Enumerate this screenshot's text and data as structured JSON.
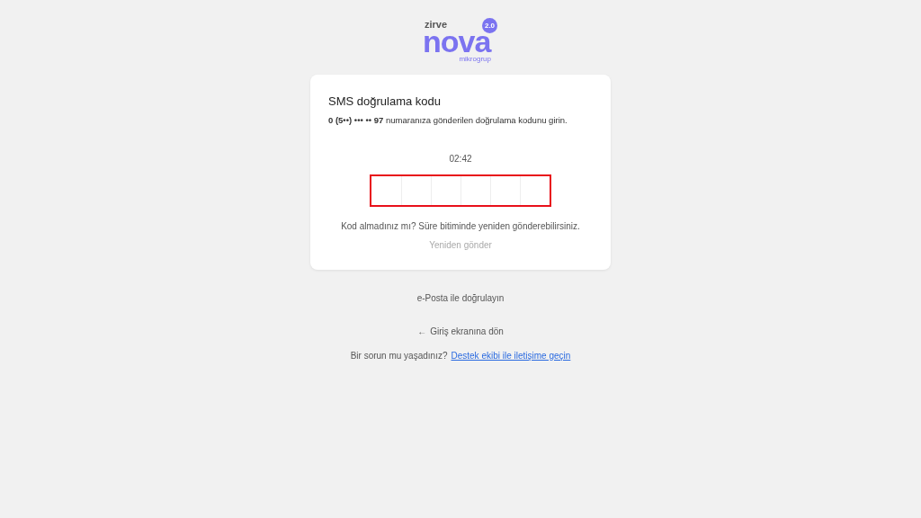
{
  "logo": {
    "top": "zirve",
    "main": "nova",
    "badge": "2.0",
    "bottom": "mikrogrup"
  },
  "card": {
    "title": "SMS doğrulama kodu",
    "message": "**0 (5••) ••• •• 97** numaranıza gönderilen doğrulama kodunu girin.",
    "timer": "02:42",
    "code": {
      "error": true,
      "cells": [
        {
          "filled": false
        },
        {
          "filled": false
        },
        {
          "filled": false
        },
        {
          "filled": false
        },
        {
          "filled": false
        },
        {
          "filled": false
        }
      ]
    },
    "hint": "Kod almadınız mı? Süre bitiminde yeniden gönderebilirsiniz.",
    "resend": {
      "label": "Yeniden gönder",
      "disabled": true
    }
  },
  "email_link": "e-Posta ile doğrulayın",
  "back_link": {
    "arrow": "←",
    "label": "Giriş ekranına dön"
  },
  "support": {
    "text": "Bir sorun mu yaşadınız?",
    "link": "Destek ekibi ile iletişime geçin"
  }
}
